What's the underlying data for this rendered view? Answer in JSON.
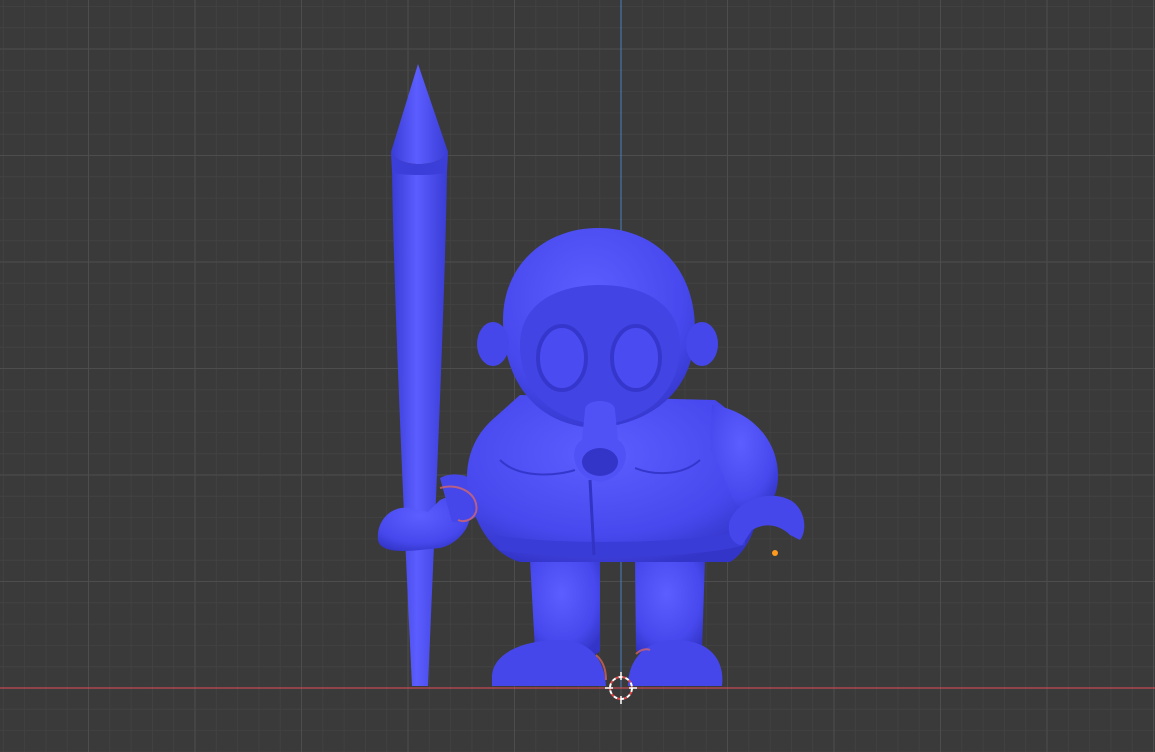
{
  "viewport": {
    "background_color": "#3a3a3a",
    "grid_minor_color": "#424242",
    "grid_major_color": "#4d4d4d",
    "x_axis_color": "#c44b53",
    "y_axis_color": "#4f7fbf",
    "model_color": "#4a4cf2",
    "model_highlight_color": "#6567ff",
    "model_shadow_color": "#3032c4",
    "selection_outline_color": "#e8824a",
    "origin_dot_color": "#ff9a1f",
    "cursor_icon": "3d-cursor-icon",
    "model_description_icon": "gasmask-figure-with-spear-icon"
  }
}
